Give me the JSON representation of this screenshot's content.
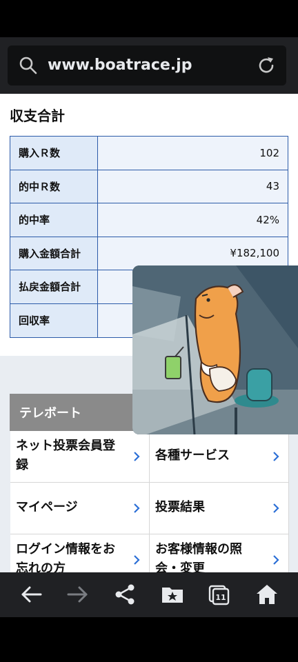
{
  "browser": {
    "url": "www.boatrace.jp",
    "tab_count": "11"
  },
  "summary": {
    "title": "収支合計",
    "rows": [
      {
        "label": "購入Ｒ数",
        "value": "102"
      },
      {
        "label": "的中Ｒ数",
        "value": "43"
      },
      {
        "label": "的中率",
        "value": "42%"
      },
      {
        "label": "購入金額合計",
        "value": "¥182,100"
      },
      {
        "label": "払戻金額合計",
        "value": ""
      },
      {
        "label": "回収率",
        "value": ""
      }
    ]
  },
  "teleport": {
    "title": "テレボート",
    "links": [
      {
        "label": "ネット投票会員登録"
      },
      {
        "label": "各種サービス"
      },
      {
        "label": "マイページ"
      },
      {
        "label": "投票結果"
      },
      {
        "label": "ログイン情報をお忘れの方"
      },
      {
        "label": "お客様情報の照会・変更"
      }
    ]
  },
  "overlay": {
    "description_icon": "sticker-character-icon"
  },
  "colors": {
    "table_border": "#2b5aa8",
    "label_bg": "#dfeaf8",
    "value_bg": "#eef3fb",
    "teleport_header": "#8a8a8a",
    "chevron": "#2b6fd6"
  }
}
